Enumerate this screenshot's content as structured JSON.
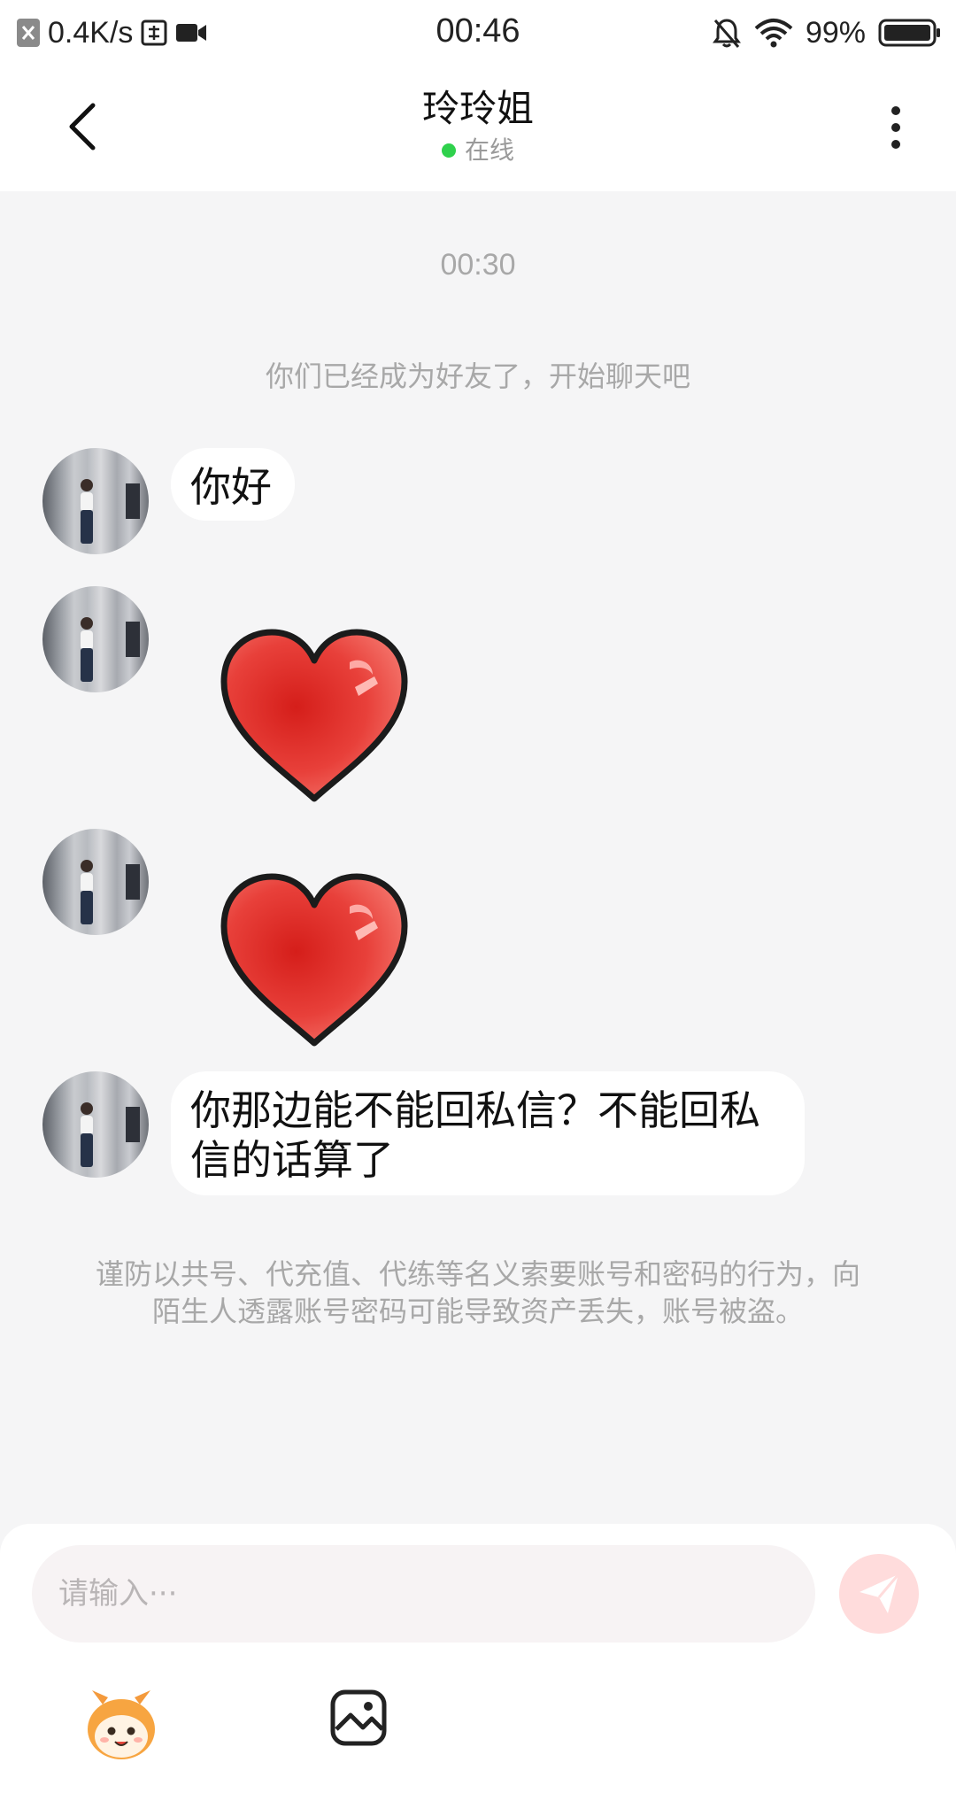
{
  "status_bar": {
    "net_speed": "0.4K/s",
    "time": "00:46",
    "battery": "99%"
  },
  "header": {
    "title": "玲玲姐",
    "status": "在线"
  },
  "chat": {
    "timestamp": "00:30",
    "system_message": "你们已经成为好友了，开始聊天吧",
    "messages": [
      {
        "type": "text",
        "text": "你好"
      },
      {
        "type": "sticker",
        "icon": "heart-sticker"
      },
      {
        "type": "sticker",
        "icon": "heart-sticker"
      },
      {
        "type": "text",
        "line1": "你那边能不能回私信？不能回私",
        "line2": "信的话算了"
      }
    ],
    "warning": "谨防以共号、代充值、代练等名义索要账号和密码的行为，向陌生人透露账号密码可能导致资产丢失，账号被盗。"
  },
  "input": {
    "placeholder": "请输入···",
    "value": ""
  },
  "colors": {
    "online_dot": "#2fd14c",
    "send_button": "#ffdcdc",
    "background": "#f5f5f6"
  }
}
